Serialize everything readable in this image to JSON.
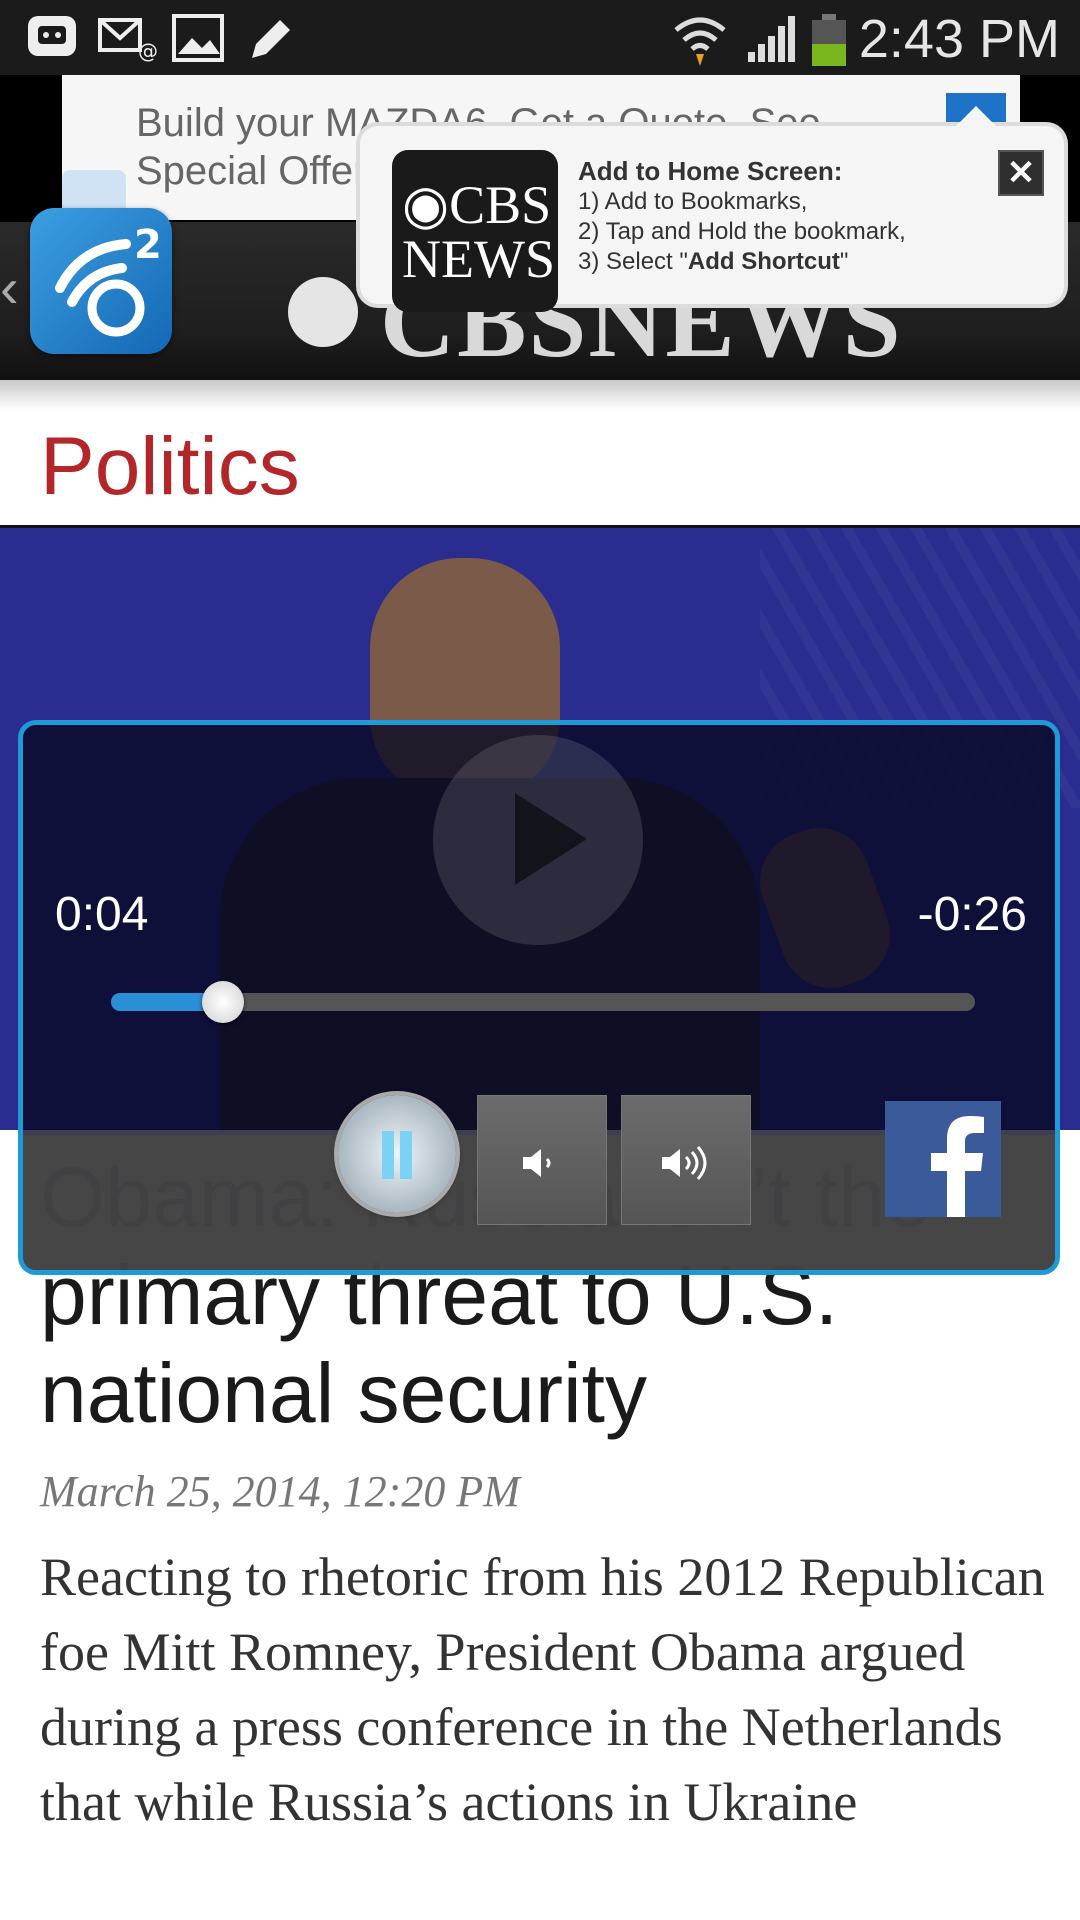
{
  "status_bar": {
    "time": "2:43 PM",
    "icons": [
      "chat-icon",
      "mail-icon",
      "image-icon",
      "pencil-icon",
      "wifi-icon",
      "signal-icon",
      "battery-icon"
    ]
  },
  "ad": {
    "line1": "Build your MAZDA6. Get a Quote. See",
    "line2": "Special Offer"
  },
  "popup": {
    "logo_line1": "◉CBS",
    "logo_line2": "NEWS",
    "title": "Add to Home Screen:",
    "step1": "1) Add to Bookmarks,",
    "step2": "2) Tap and Hold the bookmark,",
    "step3_prefix": "3) Select \"",
    "step3_bold": "Add Shortcut",
    "step3_suffix": "\"",
    "close_label": "✕"
  },
  "header": {
    "logo_text": "CBSNEWS"
  },
  "section": {
    "title": "Politics"
  },
  "player": {
    "elapsed": "0:04",
    "remaining": "-0:26",
    "progress": 0.13
  },
  "article": {
    "headline": "Obama: Russia isn’t the primary threat to U.S. national security",
    "date": "March 25, 2014, 12:20 PM",
    "body": "Reacting to rhetoric from his 2012 Republican foe Mitt Romney, President Obama argued during a press conference in the Netherlands that while Russia’s actions in Ukraine"
  },
  "colors": {
    "accent_red": "#b3262a",
    "player_border": "#1f9ad6",
    "facebook_blue": "#3b5a9a"
  }
}
